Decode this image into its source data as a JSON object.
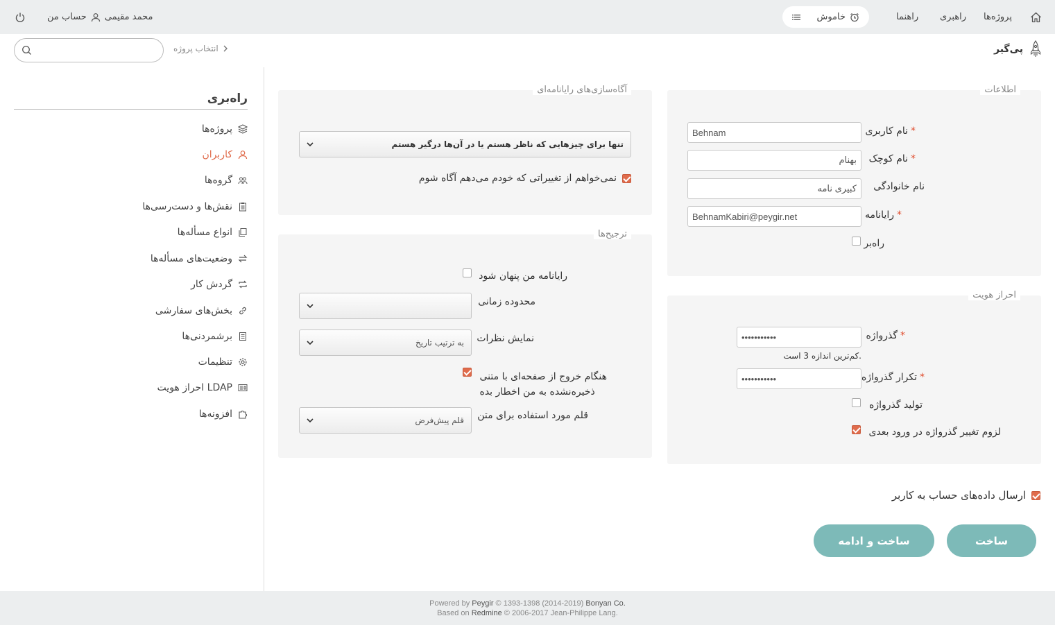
{
  "topbar": {
    "user_name": "محمد مقیمی",
    "my_account": "حساب من",
    "status_label": "خاموش",
    "nav": {
      "projects": "پروژه‌ها",
      "admin": "راهبری",
      "help": "راهنما"
    }
  },
  "subbar": {
    "search_placeholder": "",
    "project_select": "انتخاب پروژه",
    "brand": "پی‌گیر"
  },
  "sidebar": {
    "title": "راه‌بری",
    "items": [
      {
        "label": "پروژه‌ها",
        "icon": "layers-icon"
      },
      {
        "label": "کاربران",
        "icon": "user-icon"
      },
      {
        "label": "گروه‌ها",
        "icon": "group-icon"
      },
      {
        "label": "نقش‌ها و دست‌رسی‌ها",
        "icon": "clipboard-icon"
      },
      {
        "label": "انواع مسأله‌ها",
        "icon": "copy-icon"
      },
      {
        "label": "وضعیت‌های مسأله‌ها",
        "icon": "swap-icon"
      },
      {
        "label": "گردش کار",
        "icon": "cycle-icon"
      },
      {
        "label": "بخش‌های سفارشی",
        "icon": "link-icon"
      },
      {
        "label": "برشمردنی‌ها",
        "icon": "list-icon"
      },
      {
        "label": "تنظیمات",
        "icon": "gear-icon"
      },
      {
        "label": "احراز هویت LDAP",
        "icon": "id-card-icon"
      },
      {
        "label": "افزونه‌ها",
        "icon": "puzzle-icon"
      }
    ]
  },
  "info": {
    "legend": "اطلاعات",
    "login_label": "نام کاربری",
    "login_value": "Behnam",
    "firstname_label": "نام کوچک",
    "firstname_value": "بهنام",
    "lastname_label": "نام خانوادگی",
    "lastname_value": "کبیری نامه",
    "email_label": "رایانامه",
    "email_value": "BehnamKabiri@peygir.net",
    "admin_label": "راه‌بر",
    "required_mark": "*"
  },
  "auth": {
    "legend": "احراز هویت",
    "password_label": "گذرواژه",
    "password_value": "•••••••••••",
    "password_hint": "کم‌ترین اندازه 3 است.",
    "confirm_label": "تکرار گذرواژه",
    "confirm_value": "•••••••••••",
    "generate_label": "تولید گذرواژه",
    "must_change_label": "لزوم تغییر گذرواژه در ورود بعدی"
  },
  "notifications": {
    "legend": "آگاه‌سازی‌های رایانامه‌ای",
    "select_value": "تنها برای چیزهایی که ناظر هستم یا در آن‌ها درگیر هستم",
    "no_self_label": "نمی‌خواهم از تغییراتی که خودم می‌دهم آگاه شوم"
  },
  "prefs": {
    "legend": "ترجیح‌ها",
    "hide_mail_label": "رایانامه من پنهان شود",
    "timezone_label": "محدوده زمانی",
    "timezone_value": "",
    "comments_label": "نمایش نظرات",
    "comments_value": "به ترتیب تاریخ",
    "warn_line1": "هنگام خروج از صفحه‌ای با متنی",
    "warn_line2": "ذخیره‌نشده به من اخطار بده",
    "font_label": "قلم مورد استفاده برای متن",
    "font_value": "قلم پیش‌فرض"
  },
  "send_info_label": "ارسال داده‌های حساب به کاربر",
  "buttons": {
    "create": "ساخت",
    "create_continue": "ساخت و ادامه"
  },
  "footer": {
    "powered_by": "Powered by",
    "peygir": "Peygir",
    "peygir_years": "© 1393-1398 (2014-2019)",
    "company": "Bonyan Co.",
    "based_on": "Based on",
    "redmine": "Redmine",
    "redmine_years": "© 2006-2017 Jean-Philippe Lang."
  },
  "colors": {
    "accent": "#e06c4c",
    "button": "#7dbab8",
    "bar": "#eceeef",
    "panel": "#f5f5f5"
  }
}
